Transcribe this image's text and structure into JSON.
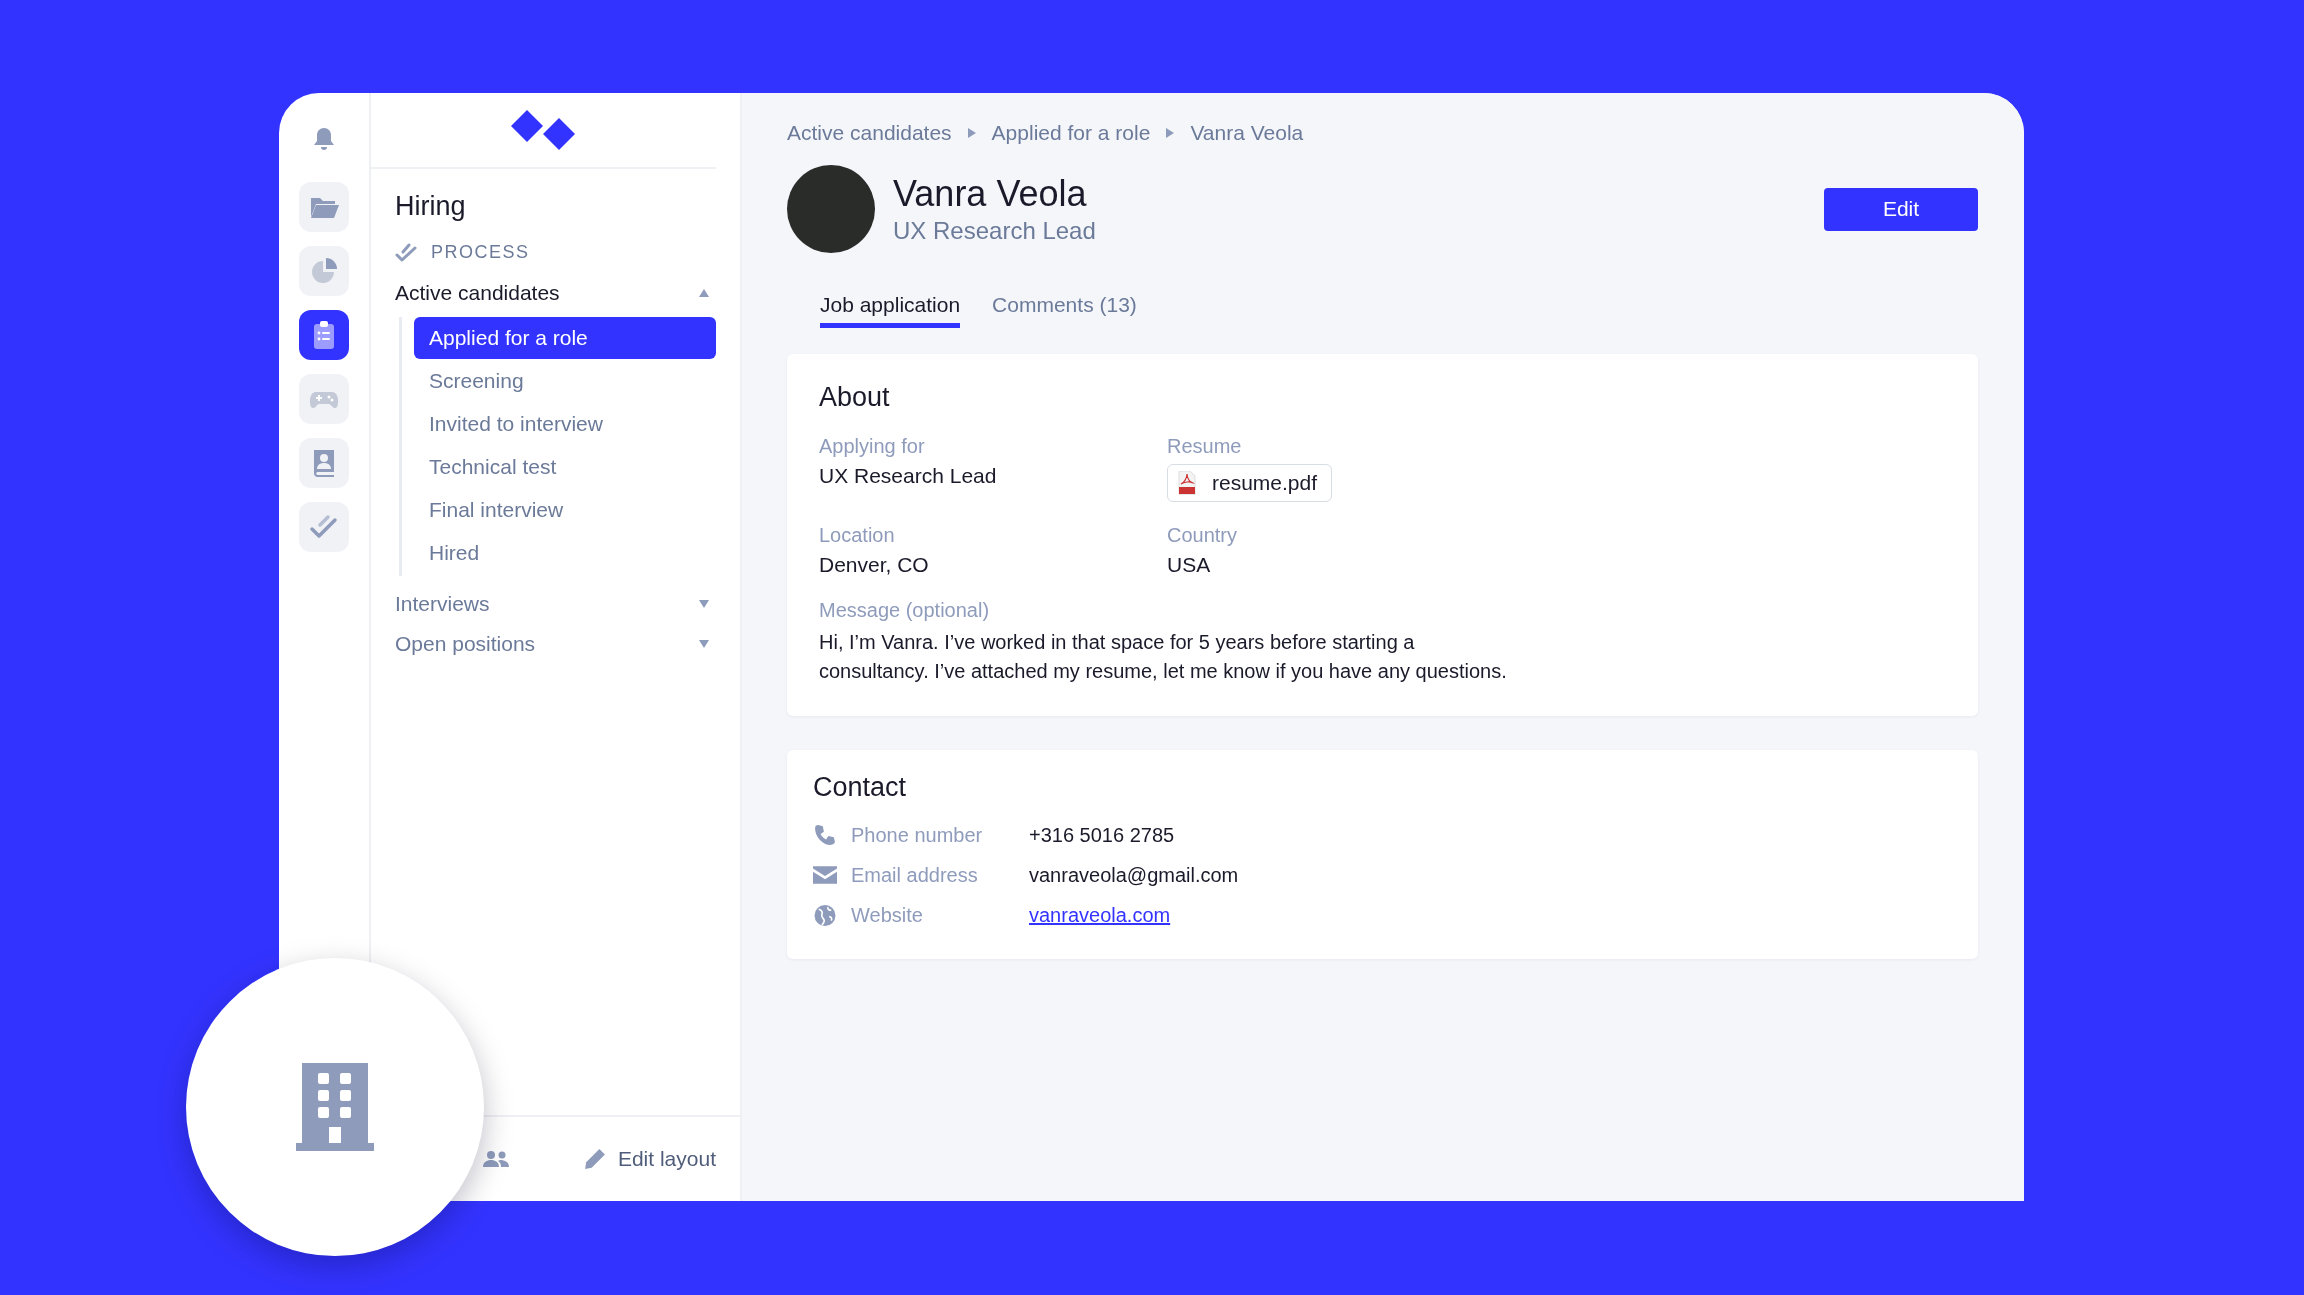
{
  "rail": {
    "items": [
      {
        "selected": false
      },
      {
        "selected": false
      },
      {
        "selected": true
      },
      {
        "selected": false
      },
      {
        "selected": false
      },
      {
        "selected": false
      }
    ]
  },
  "sidebar": {
    "title": "Hiring",
    "section": "PROCESS",
    "groups": [
      {
        "label": "Active candidates",
        "expanded": true,
        "children": [
          {
            "label": "Applied for a role",
            "selected": true
          },
          {
            "label": "Screening",
            "selected": false
          },
          {
            "label": "Invited to interview",
            "selected": false
          },
          {
            "label": "Technical test",
            "selected": false
          },
          {
            "label": "Final interview",
            "selected": false
          },
          {
            "label": "Hired",
            "selected": false
          }
        ]
      },
      {
        "label": "Interviews",
        "expanded": false
      },
      {
        "label": "Open positions",
        "expanded": false
      }
    ],
    "footer": {
      "edit_layout": "Edit layout"
    }
  },
  "breadcrumb": [
    "Active candidates",
    "Applied for a role",
    "Vanra Veola"
  ],
  "profile": {
    "name": "Vanra Veola",
    "role": "UX Research Lead"
  },
  "edit_button": "Edit",
  "tabs": [
    {
      "label": "Job application",
      "selected": true
    },
    {
      "label": "Comments (13)",
      "selected": false
    }
  ],
  "about": {
    "title": "About",
    "fields": [
      {
        "label": "Applying for",
        "value": "UX Research Lead",
        "kind": "text"
      },
      {
        "label": "Resume",
        "value": "resume.pdf",
        "kind": "file"
      },
      {
        "label": "Location",
        "value": "Denver, CO",
        "kind": "text"
      },
      {
        "label": "Country",
        "value": "USA",
        "kind": "text"
      }
    ],
    "message": {
      "label": "Message (optional)",
      "text": "Hi, I’m Vanra. I’ve worked in that space for 5 years before starting a consultancy. I’ve attached my resume, let me know if you have any questions."
    }
  },
  "contact": {
    "title": "Contact",
    "rows": [
      {
        "label": "Phone number",
        "value": "+316 5016 2785",
        "kind": "phone"
      },
      {
        "label": "Email address",
        "value": "vanraveola@gmail.com",
        "kind": "email"
      },
      {
        "label": "Website",
        "value": "vanraveola.com",
        "kind": "website"
      }
    ]
  }
}
